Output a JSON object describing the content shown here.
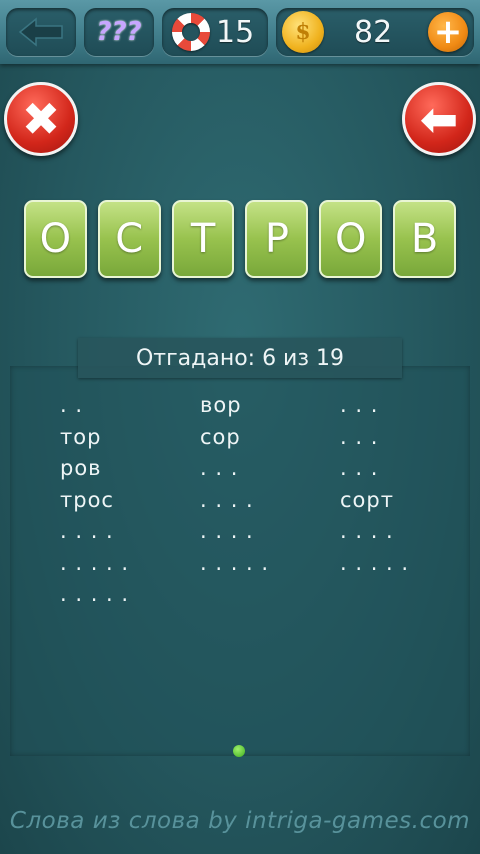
{
  "topbar": {
    "back_icon": "arrow-left-icon",
    "hint_label": "???",
    "lives": "15",
    "coins": "82",
    "coin_symbol": "$",
    "plus_label": "+"
  },
  "controls": {
    "close_label": "✖",
    "undo_label": "⬅"
  },
  "word": {
    "letters": [
      "О",
      "С",
      "Т",
      "Р",
      "О",
      "В"
    ]
  },
  "progress": {
    "text": "Отгадано: 6 из 19"
  },
  "words": {
    "columns": [
      [
        ". .",
        "тор",
        "ров",
        "трос",
        ". . . .",
        ". . . . .",
        ". . . . ."
      ],
      [
        "вор",
        "сор",
        ". . .",
        ". . . .",
        ". . . .",
        ". . . . ."
      ],
      [
        ". . .",
        ". . .",
        ". . .",
        "сорт",
        ". . . .",
        ". . . . ."
      ]
    ]
  },
  "footer": {
    "text": "Слова из слова by intriga-games.com"
  },
  "colors": {
    "tile_green": "#98c24e",
    "button_red": "#d2261a",
    "background": "#25585f"
  }
}
